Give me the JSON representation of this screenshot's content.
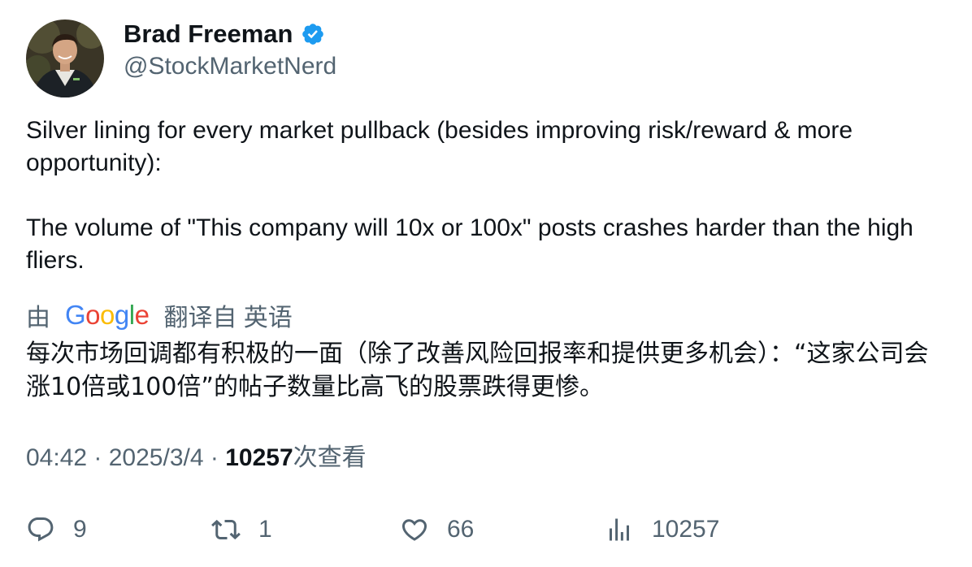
{
  "author": {
    "display_name": "Brad Freeman",
    "handle": "@StockMarketNerd",
    "verified": true,
    "avatar_icon": "profile-photo"
  },
  "tweet": {
    "paragraph_1": "Silver lining for every market pullback (besides improving risk/reward & more opportunity):",
    "paragraph_2": "The volume of \"This company will 10x or 100x\" posts crashes harder than the high fliers."
  },
  "translation": {
    "by_label": "由",
    "provider": "Google",
    "translated_from_label": "翻译自 英语",
    "text": "每次市场回调都有积极的一面（除了改善风险回报率和提供更多机会）：“这家公司会涨10倍或100倍”的帖子数量比高飞的股票跌得更惨。"
  },
  "meta": {
    "time": "04:42",
    "separator": "·",
    "date": "2025/3/4",
    "views_count": "10257",
    "views_label": "次查看"
  },
  "actions": {
    "replies": "9",
    "retweets": "1",
    "likes": "66",
    "views": "10257"
  },
  "colors": {
    "text_primary": "#0f1419",
    "text_secondary": "#536471",
    "verified_blue": "#1d9bf0",
    "google_blue": "#4285F4",
    "google_red": "#EA4335",
    "google_yellow": "#FBBC05",
    "google_green": "#34A853"
  }
}
